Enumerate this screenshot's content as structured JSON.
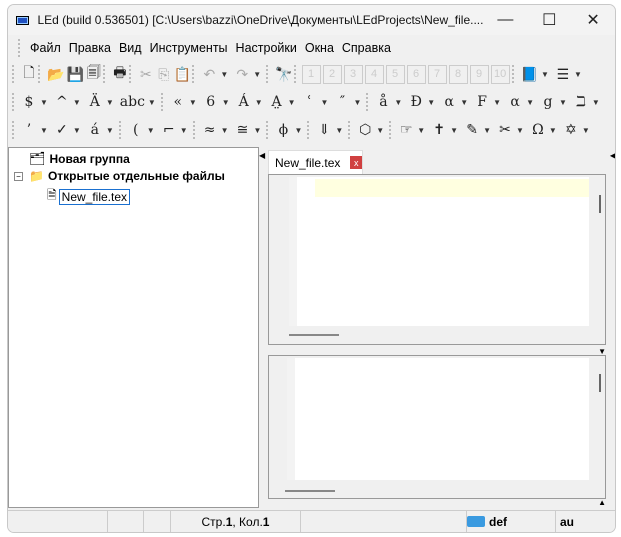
{
  "window": {
    "title": "LEd (build 0.536501) [C:\\Users\\bazzi\\OneDrive\\Документы\\LEdProjects\\New_file...."
  },
  "menu": [
    "Файл",
    "Правка",
    "Вид",
    "Инструменты",
    "Настройки",
    "Окна",
    "Справка"
  ],
  "toolbar1": [
    {
      "g": "🗋",
      "n": "new-file-icon"
    },
    {
      "g": "📂",
      "n": "open-folder-icon"
    },
    {
      "g": "💾",
      "n": "save-icon"
    },
    {
      "g": "🗐",
      "n": "save-all-icon"
    },
    {
      "g": "🖶",
      "n": "print-icon"
    },
    {
      "g": "✂",
      "n": "cut-icon",
      "d": 1
    },
    {
      "g": "⎘",
      "n": "copy-icon",
      "d": 1
    },
    {
      "g": "📋",
      "n": "paste-icon"
    },
    {
      "g": "↶",
      "n": "undo-icon",
      "d": 1,
      "dd": 1
    },
    {
      "g": "↷",
      "n": "redo-icon",
      "d": 1,
      "dd": 1
    },
    {
      "g": "🔭",
      "n": "find-icon"
    }
  ],
  "bookmarks": [
    "1",
    "2",
    "3",
    "4",
    "5",
    "6",
    "7",
    "8",
    "9",
    "10"
  ],
  "toolbar1_end": [
    {
      "g": "📘",
      "n": "book-icon",
      "dd": 1
    },
    {
      "g": "☰",
      "n": "list-icon",
      "dd": 1
    }
  ],
  "toolbar2": [
    "$",
    "^",
    "Ä",
    "abc",
    "«",
    "6",
    "Á",
    "A̤",
    "ʿ",
    "″",
    "å",
    "Đ",
    "α",
    "F",
    "α",
    "g",
    "ℶ"
  ],
  "toolbar3": [
    "’",
    "✓",
    "á",
    "(",
    "⌐",
    "≈",
    "≅",
    "ϕ",
    "⇓",
    "⬡",
    "☞",
    "✝",
    "✎",
    "✂",
    "Ω",
    "✡"
  ],
  "tree": {
    "group": "Новая группа",
    "open_files": "Открытые отдельные файлы",
    "file": "New_file.tex"
  },
  "editor": {
    "tab": "New_file.tex",
    "close": "x"
  },
  "status": {
    "position_prefix": "Стр. ",
    "line": "1",
    "sep": ", Кол. ",
    "col": "1",
    "mode": "def",
    "extra": "au"
  }
}
